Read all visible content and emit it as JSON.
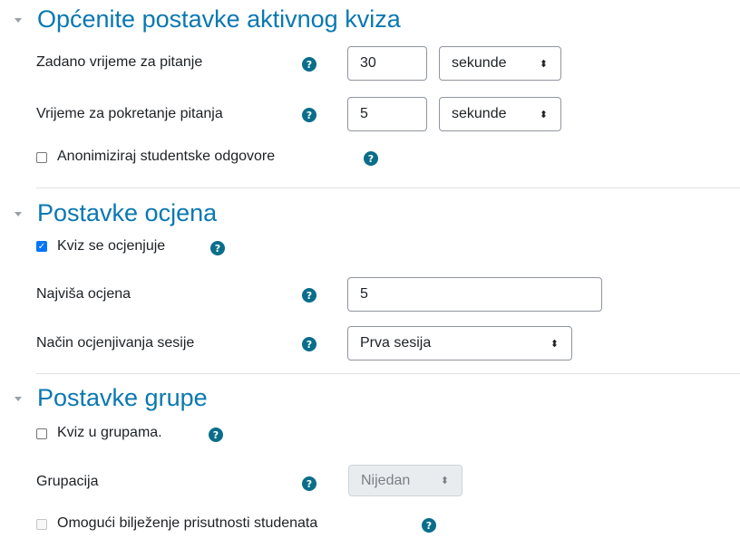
{
  "sections": [
    {
      "title": "Općenite postavke aktivnog kviza"
    },
    {
      "title": "Postavke ocjena"
    },
    {
      "title": "Postavke grupe"
    }
  ],
  "general": {
    "question_time_label": "Zadano vrijeme za pitanje",
    "question_time_value": "30",
    "question_time_unit": "sekunde",
    "start_time_label": "Vrijeme za pokretanje pitanja",
    "start_time_value": "5",
    "start_time_unit": "sekunde",
    "anonymize_label": "Anonimiziraj studentske odgovore",
    "anonymize_checked": false
  },
  "grading": {
    "graded_label": "Kviz se ocjenjuje",
    "graded_checked": true,
    "max_grade_label": "Najviša ocjena",
    "max_grade_value": "5",
    "session_grading_label": "Način ocjenjivanja sesije",
    "session_grading_value": "Prva sesija"
  },
  "groups": {
    "group_mode_label": "Kviz u grupama.",
    "group_mode_checked": false,
    "grouping_label": "Grupacija",
    "grouping_value": "Nijedan",
    "attendance_label": "Omogući bilježenje prisutnosti studenata",
    "attendance_checked": false
  },
  "icons": {
    "help": "question-circle-icon",
    "collapse": "caret-down-icon",
    "select_caret": "sort-icon"
  },
  "colors": {
    "section_title": "#0a78b2",
    "help_icon": "#0a6e8a",
    "checkbox_checked": "#0075ff"
  }
}
